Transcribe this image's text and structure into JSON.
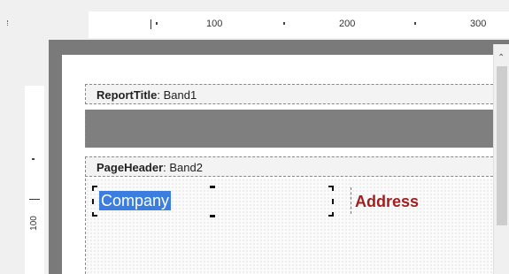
{
  "ruler": {
    "top_labels": [
      "100",
      "200",
      "300"
    ],
    "left_labels": [
      "100"
    ]
  },
  "bands": [
    {
      "type": "ReportTitle",
      "name": "Band1"
    },
    {
      "type": "PageHeader",
      "name": "Band2"
    }
  ],
  "controls": {
    "company_label": "Company",
    "address_label": "Address"
  },
  "colors": {
    "selection": "#3b7ee0",
    "address_text": "#a02020",
    "frame": "#7a7a7a"
  }
}
